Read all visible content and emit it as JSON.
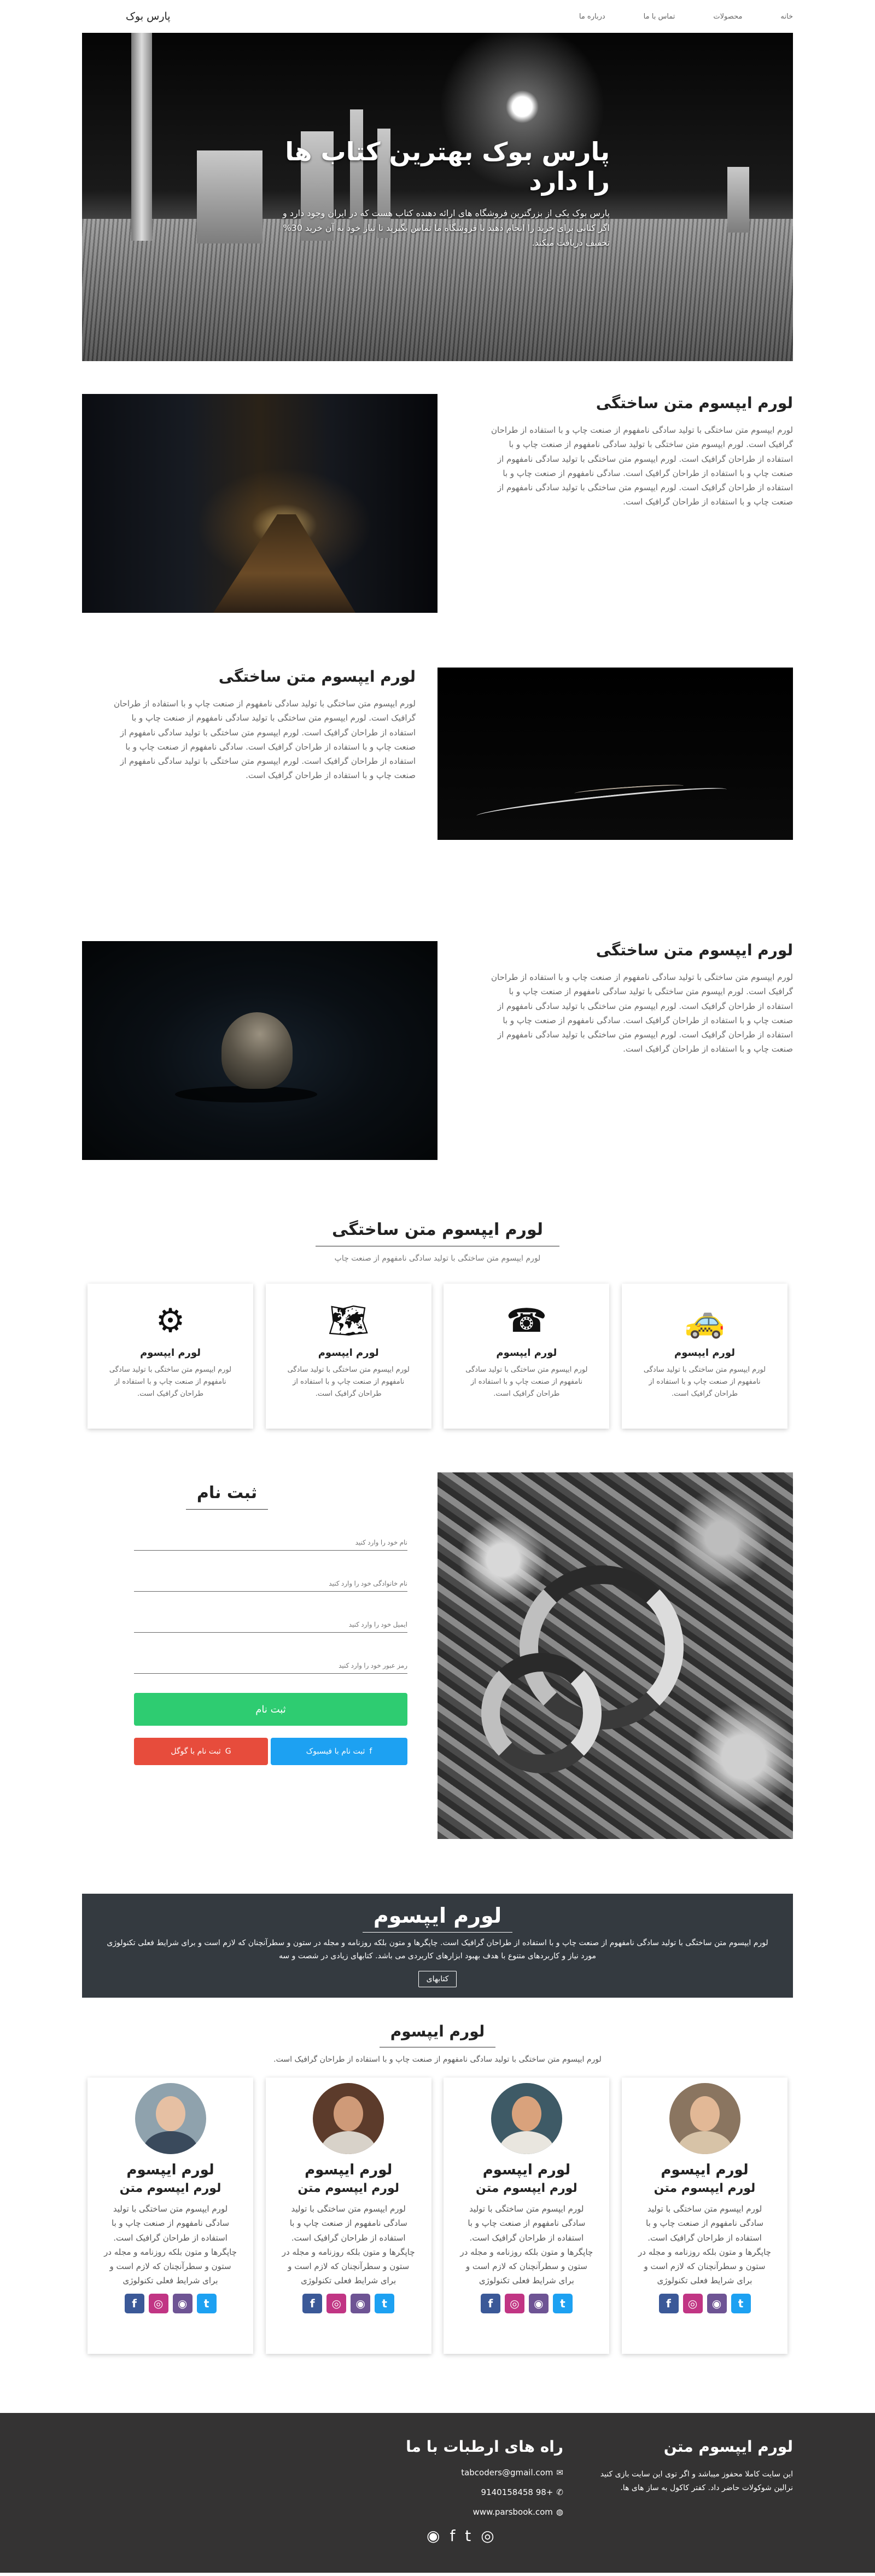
{
  "nav": {
    "brand": "پارس بوک",
    "links": [
      "خانه",
      "محصولات",
      "تماس با ما",
      "درباره ما"
    ]
  },
  "hero": {
    "title": "پارس بوک بهترین کتاب ها را دارد",
    "text": "پارس بوک یکی از بزرگترین فروشگاه های ارائه دهنده کتاب هست که در ایران وجود دارد و اگر کتابی برای خرید را انجام دهید با فروشگاه ما تماس بگیرید تا نیاز خود به آن خرید 30% تخفیف دریافت میکند."
  },
  "features": [
    {
      "title": "لورم ایپسوم متن ساختگی",
      "text": "لورم ایپسوم متن ساختگی با تولید سادگی نامفهوم از صنعت چاپ و با استفاده از طراحان گرافیک است. لورم ایپسوم متن ساختگی با تولید سادگی نامفهوم از صنعت چاپ و با استفاده از طراحان گرافیک است. لورم ایپسوم متن ساختگی با تولید سادگی نامفهوم از صنعت چاپ و با استفاده از طراحان گرافیک است. سادگی نامفهوم از صنعت چاپ و با استفاده از طراحان گرافیک است. لورم ایپسوم متن ساختگی با تولید سادگی نامفهوم از صنعت چاپ و با استفاده از طراحان گرافیک است."
    },
    {
      "title": "لورم ایپسوم متن ساختگی",
      "text": "لورم ایپسوم متن ساختگی با تولید سادگی نامفهوم از صنعت چاپ و با استفاده از طراحان گرافیک است. لورم ایپسوم متن ساختگی با تولید سادگی نامفهوم از صنعت چاپ و با استفاده از طراحان گرافیک است. لورم ایپسوم متن ساختگی با تولید سادگی نامفهوم از صنعت چاپ و با استفاده از طراحان گرافیک است. سادگی نامفهوم از صنعت چاپ و با استفاده از طراحان گرافیک است. لورم ایپسوم متن ساختگی با تولید سادگی نامفهوم از صنعت چاپ و با استفاده از طراحان گرافیک است."
    },
    {
      "title": "لورم ایپسوم متن ساختگی",
      "text": "لورم ایپسوم متن ساختگی با تولید سادگی نامفهوم از صنعت چاپ و با استفاده از طراحان گرافیک است. لورم ایپسوم متن ساختگی با تولید سادگی نامفهوم از صنعت چاپ و با استفاده از طراحان گرافیک است. لورم ایپسوم متن ساختگی با تولید سادگی نامفهوم از صنعت چاپ و با استفاده از طراحان گرافیک است. سادگی نامفهوم از صنعت چاپ و با استفاده از طراحان گرافیک است. لورم ایپسوم متن ساختگی با تولید سادگی نامفهوم از صنعت چاپ و با استفاده از طراحان گرافیک است."
    }
  ],
  "services": {
    "title": "لورم ایپسوم متن ساختگی",
    "subtitle": "لورم ایپسوم متن ساختگی با تولید سادگی نامفهوم از صنعت چاپ",
    "items": [
      {
        "icon": "taxi-dollar-icon",
        "glyph": "🚕",
        "title": "لورم ایپسوم",
        "text": "لورم ایپسوم متن ساختگی با تولید سادگی نامفهوم از صنعت چاپ و با استفاده از طراحان گرافیک است."
      },
      {
        "icon": "phone-247-icon",
        "glyph": "☎",
        "title": "لورم ایپسوم",
        "text": "لورم ایپسوم متن ساختگی با تولید سادگی نامفهوم از صنعت چاپ و با استفاده از طراحان گرافیک است."
      },
      {
        "icon": "world-map-icon",
        "glyph": "🗺",
        "title": "لورم ایپسوم",
        "text": "لورم ایپسوم متن ساختگی با تولید سادگی نامفهوم از صنعت چاپ و با استفاده از طراحان گرافیک است."
      },
      {
        "icon": "gear-icon",
        "glyph": "⚙",
        "title": "لورم ایپسوم",
        "text": "لورم ایپسوم متن ساختگی با تولید سادگی نامفهوم از صنعت چاپ و با استفاده از طراحان گرافیک است."
      }
    ]
  },
  "signup": {
    "title": "ثبت نام",
    "placeholders": [
      "نام خود را وارد کنید",
      "نام خانوادگی خود را وارد کنید",
      "ایمیل خود را وارد کنید",
      "رمز عبور خود را وارد کنید"
    ],
    "submit": "ثبت نام",
    "facebook": "ثبت نام با فیسبوک",
    "google": "ثبت نام با گوگل"
  },
  "banner": {
    "title": "لورم ایپسوم",
    "text": "لورم ایپسوم متن ساختگی با تولید سادگی نامفهوم از صنعت چاپ و با استفاده از طراحان گرافیک است. چاپگرها و متون بلکه روزنامه و مجله در ستون و سطرآنچنان که لازم است و برای شرایط فعلی تکنولوژی مورد نیاز و کاربردهای متنوع با هدف بهبود ابزارهای کاربردی می باشد. کتابهای زیادی در شصت و سه",
    "button": "کتابهای"
  },
  "team": {
    "title": "لورم ایپسوم",
    "subtitle": "لورم ایپسوم متن ساختگی با تولید سادگی نامفهوم از صنعت چاپ و با استفاده از طراحان گرافیک است.",
    "members": [
      {
        "name": "لورم ایپسوم",
        "role": "لورم ایپسوم متن",
        "bio": "لورم ایپسوم متن ساختگی با تولید سادگی نامفهوم از صنعت چاپ و با استفاده از طراحان گرافیک است. چاپگرها و متون بلکه روزنامه و مجله در ستون و سطرآنچنان که لازم است و برای شرایط فعلی تکنولوژی"
      },
      {
        "name": "لورم ایپسوم",
        "role": "لورم ایپسوم متن",
        "bio": "لورم ایپسوم متن ساختگی با تولید سادگی نامفهوم از صنعت چاپ و با استفاده از طراحان گرافیک است. چاپگرها و متون بلکه روزنامه و مجله در ستون و سطرآنچنان که لازم است و برای شرایط فعلی تکنولوژی"
      },
      {
        "name": "لورم ایپسوم",
        "role": "لورم ایپسوم متن",
        "bio": "لورم ایپسوم متن ساختگی با تولید سادگی نامفهوم از صنعت چاپ و با استفاده از طراحان گرافیک است. چاپگرها و متون بلکه روزنامه و مجله در ستون و سطرآنچنان که لازم است و برای شرایط فعلی تکنولوژی"
      },
      {
        "name": "لورم ایپسوم",
        "role": "لورم ایپسوم متن",
        "bio": "لورم ایپسوم متن ساختگی با تولید سادگی نامفهوم از صنعت چاپ و با استفاده از طراحان گرافیک است. چاپگرها و متون بلکه روزنامه و مجله در ستون و سطرآنچنان که لازم است و برای شرایط فعلی تکنولوژی"
      }
    ]
  },
  "footer": {
    "about_title": "لورم ایپسوم متن",
    "about_text": "این سایت کاملا محفوز میباشد و اگر توی این سایت بازی کنید نرالین شوکولات حاضر داد. کفتر کاکول به ساز های ها.",
    "contact_title": "راه های ارطبات با ما",
    "email": "tabcoders@gmail.com",
    "phone": "+98 9140158458",
    "website": "www.parsbook.com"
  },
  "colors": {
    "green": "#2ecc71",
    "facebook_blue": "#1da1f2",
    "google_red": "#e74c3c",
    "dark": "#343a40"
  }
}
